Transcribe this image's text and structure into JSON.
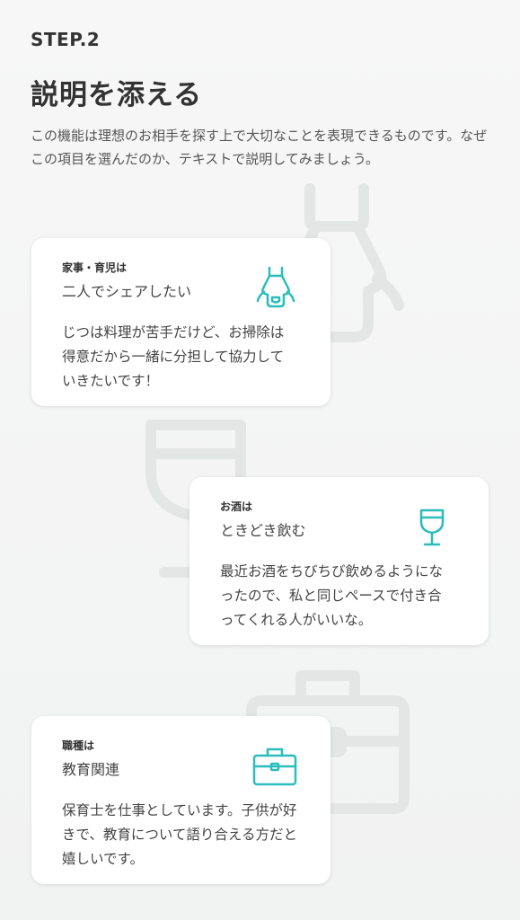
{
  "header": {
    "step": "STEP.2",
    "title": "説明を添える",
    "description": "この機能は理想のお相手を探す上で大切なことを表現できるものです。なぜこの項目を選んだのか、テキストで説明してみましょう。"
  },
  "cards": [
    {
      "label": "家事・育児は",
      "value": "二人でシェアしたい",
      "body": "じつは料理が苦手だけど、お掃除は得意だから一緒に分担して協力していきたいです！",
      "icon": "apron-icon"
    },
    {
      "label": "お酒は",
      "value": "ときどき飲む",
      "body": "最近お酒をちびちび飲めるようになったので、私と同じペースで付き合ってくれる人がいいな。",
      "icon": "wine-glass-icon"
    },
    {
      "label": "職種は",
      "value": "教育関連",
      "body": "保育士を仕事としています。子供が好きで、教育について語り合える方だと嬉しいです。",
      "icon": "briefcase-icon"
    }
  ],
  "colors": {
    "accent": "#2bbcbc",
    "bg_icon": "#e4e5e5",
    "text": "#333333"
  }
}
